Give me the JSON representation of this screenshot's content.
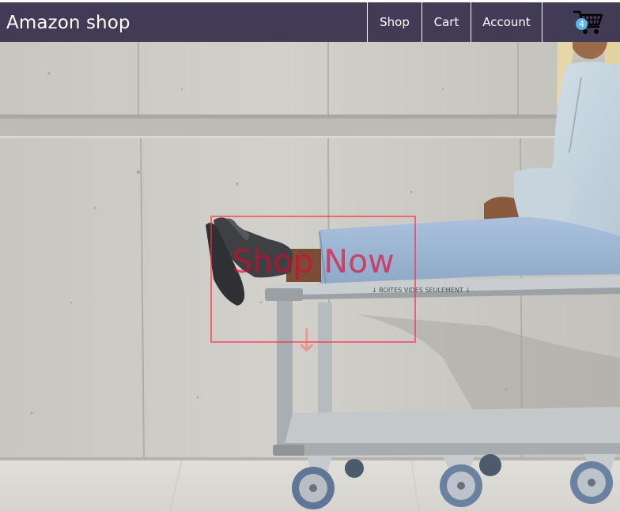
{
  "header": {
    "brand": "Amazon shop",
    "nav": [
      {
        "label": "Shop"
      },
      {
        "label": "Cart"
      },
      {
        "label": "Account"
      }
    ],
    "cart": {
      "icon": "shopping-cart-icon",
      "count": "4",
      "badge_color": "#5bb7e6"
    }
  },
  "hero": {
    "cta_label": "Shop Now",
    "cta_arrow": "↓",
    "cart_sign": "↓ BOITES VIDES SEULEMENT ↓"
  },
  "colors": {
    "navbar": "#423b56",
    "nav_text": "#ffffff",
    "cta": "#e3002d"
  }
}
